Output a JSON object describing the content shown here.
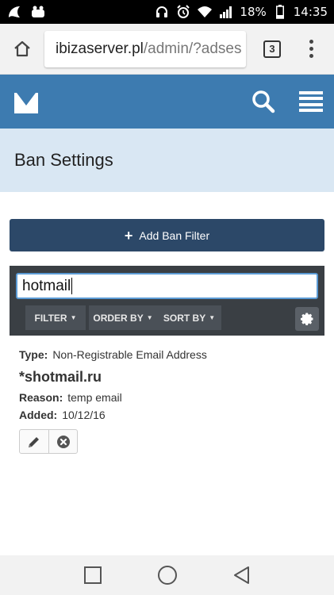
{
  "status_bar": {
    "battery": "18%",
    "time": "14:35",
    "icons": [
      "headset-icon",
      "alarm-icon",
      "wifi-icon",
      "signal-icon",
      "battery-icon"
    ]
  },
  "browser": {
    "url_host": "ibizaserver.pl",
    "url_path": "/admin/?adses",
    "tab_count": "3"
  },
  "page": {
    "title": "Ban Settings"
  },
  "actions": {
    "add_label": "Add Ban Filter"
  },
  "filter": {
    "search_value": "hotmail",
    "filter_label": "FILTER",
    "order_label": "ORDER BY",
    "sort_label": "SORT BY"
  },
  "result": {
    "type_label": "Type:",
    "type_value": "Non-Registrable Email Address",
    "name": "*shotmail.ru",
    "reason_label": "Reason:",
    "reason_value": "temp email",
    "added_label": "Added:",
    "added_value": "10/12/16"
  },
  "colors": {
    "app_bar": "#3d7bb0",
    "page_header": "#d9e7f3",
    "add_button": "#2c4868",
    "filter_panel": "#3a3f44"
  }
}
